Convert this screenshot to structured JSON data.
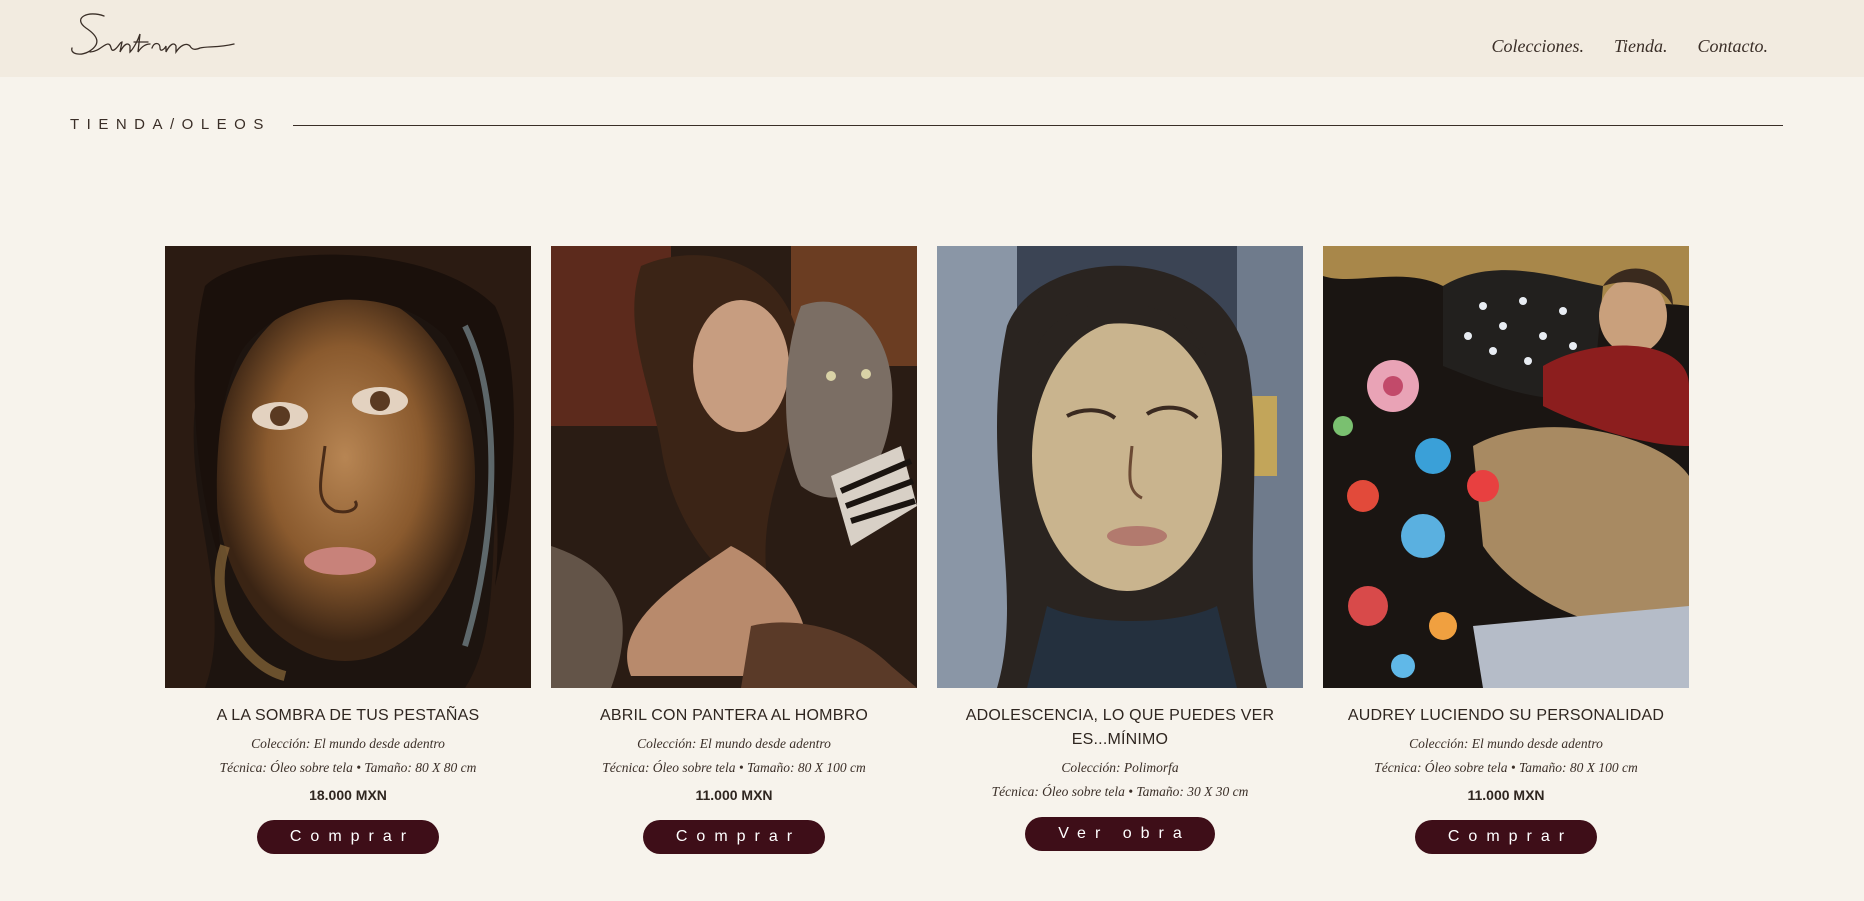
{
  "header": {
    "logo_text": "Santana",
    "nav": [
      {
        "label": "Colecciones."
      },
      {
        "label": "Tienda."
      },
      {
        "label": "Contacto."
      }
    ]
  },
  "section": {
    "breadcrumb": "TIENDA/OLEOS"
  },
  "products": [
    {
      "title": "A LA SOMBRA DE TUS PESTAÑAS",
      "collection": "Colección: El mundo desde adentro",
      "technique": "Técnica: Óleo sobre tela • Tamaño: 80 X 80 cm",
      "price": "18.000 MXN",
      "button": "Comprar",
      "image": "portrait-girl-dark-hair"
    },
    {
      "title": "ABRIL CON PANTERA AL HOMBRO",
      "collection": "Colección: El mundo desde adentro",
      "technique": "Técnica: Óleo sobre tela • Tamaño: 80 X 100 cm",
      "price": "11.000 MXN",
      "button": "Comprar",
      "image": "portrait-girl-with-cat"
    },
    {
      "title": "ADOLESCENCIA, LO QUE PUEDES VER ES...MÍNIMO",
      "collection": "Colección: Polimorfa",
      "technique": "Técnica: Óleo sobre tela • Tamaño: 30 X 30 cm",
      "price": "",
      "button": "Ver obra",
      "image": "portrait-young-woman"
    },
    {
      "title": "AUDREY LUCIENDO SU PERSONALIDAD",
      "collection": "Colección: El mundo desde adentro",
      "technique": "Técnica: Óleo sobre tela • Tamaño: 80 X 100 cm",
      "price": "11.000 MXN",
      "button": "Comprar",
      "image": "portrait-girl-floral-blanket"
    }
  ],
  "colors": {
    "background": "#f7f3ec",
    "header_bg": "#f2ebe0",
    "button_bg": "#3e0e18",
    "text": "#3a2e27"
  }
}
